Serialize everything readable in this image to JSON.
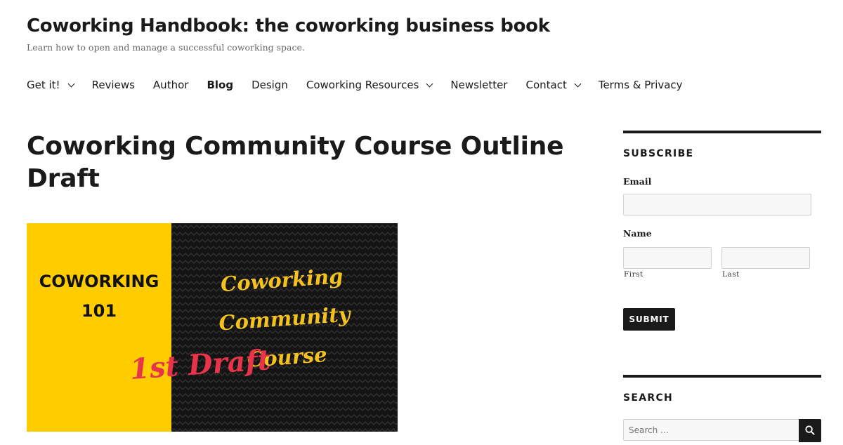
{
  "site": {
    "title": "Coworking Handbook: the coworking business book",
    "tagline": "Learn how to open and manage a successful coworking space."
  },
  "nav": {
    "items": [
      {
        "label": "Get it!",
        "has_dropdown": true
      },
      {
        "label": "Reviews",
        "has_dropdown": false
      },
      {
        "label": "Author",
        "has_dropdown": false
      },
      {
        "label": "Blog",
        "has_dropdown": false,
        "active": true
      },
      {
        "label": "Design",
        "has_dropdown": false
      },
      {
        "label": "Coworking Resources",
        "has_dropdown": true
      },
      {
        "label": "Newsletter",
        "has_dropdown": false
      },
      {
        "label": "Contact",
        "has_dropdown": true
      },
      {
        "label": "Terms & Privacy",
        "has_dropdown": false
      }
    ]
  },
  "post": {
    "title": "Coworking Community Course Outline Draft"
  },
  "featured_image": {
    "left_line1": "COWORKING",
    "left_line2": "101",
    "right_line1": "Coworking Community",
    "right_line2": "Course",
    "overlay": "1st Draft",
    "colors": {
      "left_bg": "#ffcc00",
      "right_bg": "#141414",
      "course_text": "#f4c21f",
      "draft_text": "#e8334a"
    }
  },
  "subscribe": {
    "title": "SUBSCRIBE",
    "email_label": "Email",
    "name_label": "Name",
    "first_label": "First",
    "last_label": "Last",
    "submit_label": "SUBMIT"
  },
  "search": {
    "title": "SEARCH",
    "placeholder": "Search …",
    "icon": "search-icon"
  }
}
